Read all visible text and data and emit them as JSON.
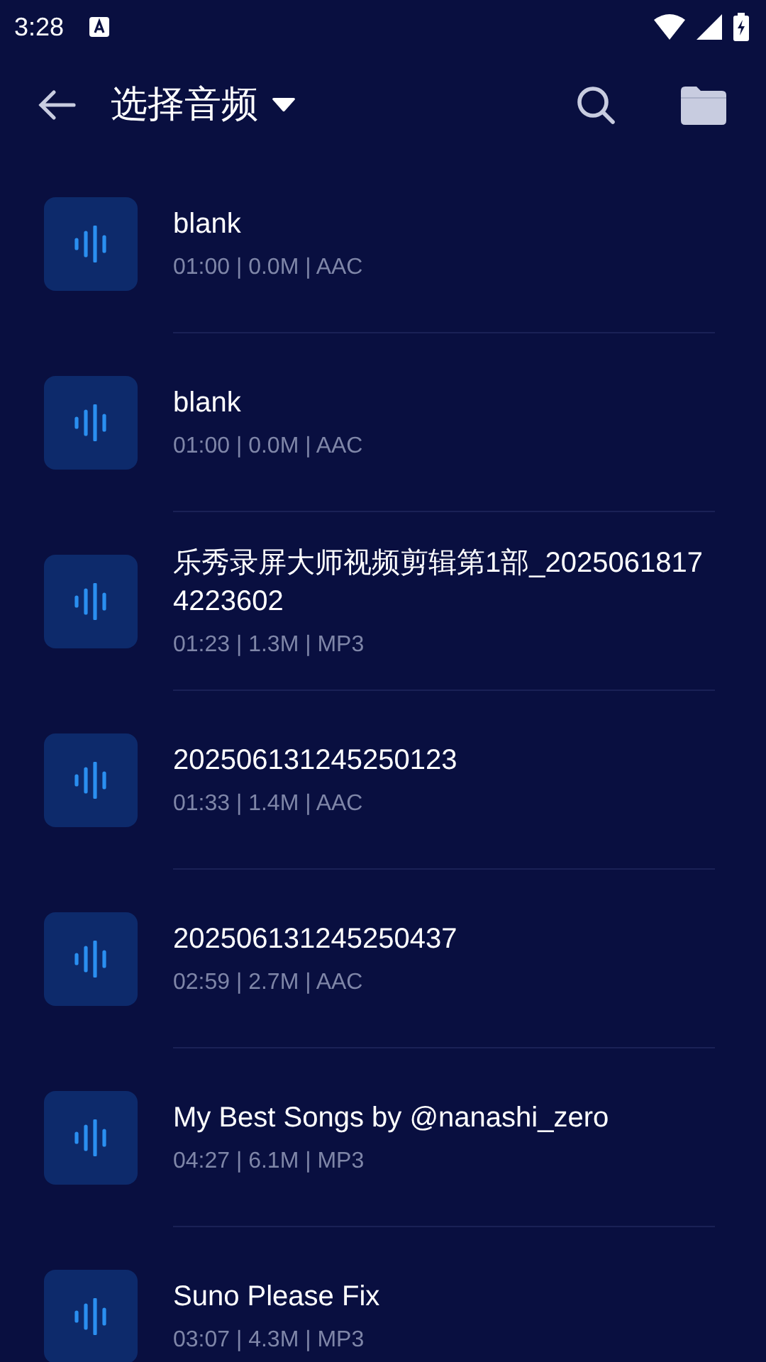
{
  "status_bar": {
    "time": "3:28"
  },
  "header": {
    "title": "选择音频"
  },
  "files": [
    {
      "name": "blank",
      "meta": "01:00 | 0.0M | AAC"
    },
    {
      "name": "blank",
      "meta": "01:00 | 0.0M | AAC"
    },
    {
      "name": "乐秀录屏大师视频剪辑第1部_20250618174223602",
      "meta": "01:23 | 1.3M | MP3"
    },
    {
      "name": "202506131245250123",
      "meta": "01:33 | 1.4M | AAC"
    },
    {
      "name": "202506131245250437",
      "meta": "02:59 | 2.7M | AAC"
    },
    {
      "name": "My Best Songs by @nanashi_zero",
      "meta": "04:27 | 6.1M | MP3"
    },
    {
      "name": "Suno Please Fix",
      "meta": "03:07 | 4.3M | MP3"
    }
  ]
}
